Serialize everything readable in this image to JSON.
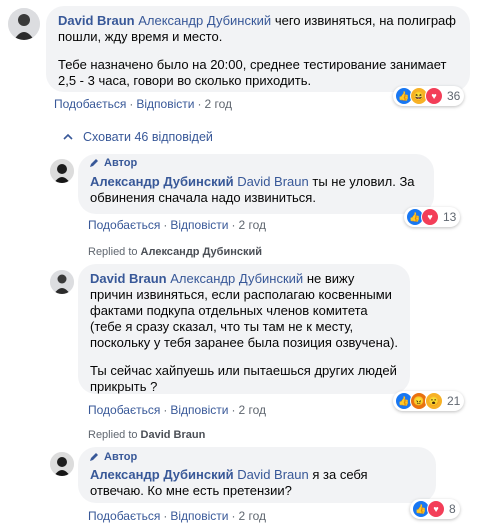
{
  "comment_main": {
    "author": "David Braun",
    "mention": "Александр Дубинский",
    "text_line1": "чего извиняться, на полиграф пошли, жду время и место.",
    "paragraph2": "Тебе назначено было на 20:00, среднее тестирование занимает 2,5 - 3 часа, говори во сколько приходить.",
    "actions": {
      "like": "Подобається",
      "reply": "Відповісти",
      "time": "2 год"
    },
    "reactions": [
      "like",
      "haha",
      "love"
    ],
    "reaction_count": "36"
  },
  "hide_replies": "Сховати 46 відповідей",
  "reply1": {
    "badge": "Автор",
    "author": "Александр Дубинский",
    "mention": "David Braun",
    "text": "ты не уловил. За обвинения сначала надо извиниться.",
    "actions": {
      "like": "Подобається",
      "reply": "Відповісти",
      "time": "2 год"
    },
    "reactions": [
      "like",
      "love"
    ],
    "reaction_count": "13"
  },
  "replied_to_1": {
    "prefix": "Replied to",
    "name": "Александр Дубинский"
  },
  "reply2": {
    "author": "David Braun",
    "mention": "Александр Дубинский",
    "text": "не вижу причин извиняться, если располагаю косвенными фактами подкупа отдельных членов комитета (тебе я сразу сказал, что ты там не к месту, поскольку у тебя заранее была позиция озвучена).",
    "paragraph2": "Ты сейчас хайпуешь или пытаешься других людей прикрыть ?",
    "actions": {
      "like": "Подобається",
      "reply": "Відповісти",
      "time": "2 год"
    },
    "reactions": [
      "like",
      "angry",
      "wow"
    ],
    "reaction_count": "21"
  },
  "replied_to_2": {
    "prefix": "Replied to",
    "name": "David Braun"
  },
  "reply3": {
    "badge": "Автор",
    "author": "Александр Дубинский",
    "mention": "David Braun",
    "text": "я за себя отвечаю. Ко мне есть претензии?",
    "actions": {
      "like": "Подобається",
      "reply": "Відповісти",
      "time": "2 год"
    },
    "reactions": [
      "like",
      "love"
    ],
    "reaction_count": "8"
  }
}
